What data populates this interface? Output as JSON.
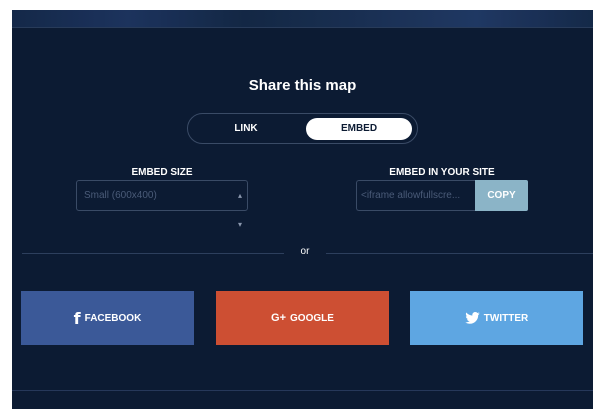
{
  "title": "Share this map",
  "toggle": {
    "link_label": "LINK",
    "embed_label": "EMBED",
    "active": "EMBED"
  },
  "embed_size": {
    "label": "EMBED SIZE",
    "selected": "Small (600x400)"
  },
  "embed_site": {
    "label": "EMBED IN YOUR SITE",
    "value": "<iframe allowfullscre...",
    "copy_label": "COPY"
  },
  "divider_text": "or",
  "social": {
    "facebook": {
      "icon": "facebook-icon",
      "label": "FACEBOOK",
      "color": "#3b5998"
    },
    "google": {
      "icon": "google-plus-icon",
      "icon_text": "G+",
      "label": "GOOGLE",
      "color": "#cd4f33"
    },
    "twitter": {
      "icon": "twitter-icon",
      "label": "TWITTER",
      "color": "#5ea6e2"
    }
  },
  "colors": {
    "background": "#0c1b33",
    "copy_button": "#8bb4c7"
  }
}
